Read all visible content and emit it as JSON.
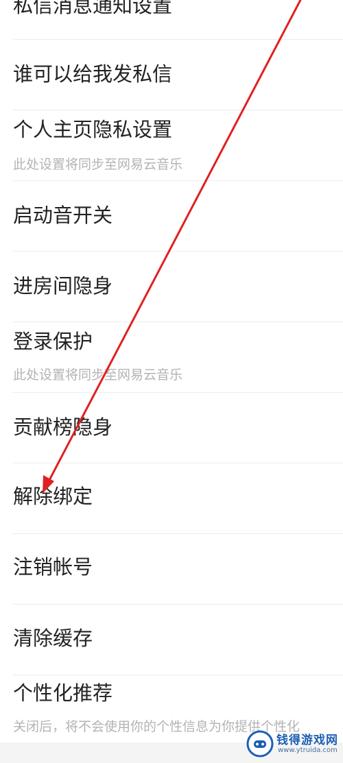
{
  "settings": {
    "items": [
      {
        "label": "私信消息通知设置"
      },
      {
        "label": "谁可以给我发私信"
      },
      {
        "label": "个人主页隐私设置",
        "sub": "此处设置将同步至网易云音乐"
      },
      {
        "label": "启动音开关"
      },
      {
        "label": "进房间隐身"
      },
      {
        "label": "登录保护",
        "sub": "此处设置将同步至网易云音乐"
      },
      {
        "label": "贡献榜隐身"
      },
      {
        "label": "解除绑定"
      },
      {
        "label": "注销帐号"
      },
      {
        "label": "清除缓存"
      },
      {
        "label": "个性化推荐",
        "sub": "关闭后，将不会使用你的个性信息为你提供个性化"
      }
    ]
  },
  "annotation": {
    "arrow_color": "#e02020"
  },
  "watermark": {
    "name": "钱得游戏网",
    "url": "www.ytruida.com"
  }
}
